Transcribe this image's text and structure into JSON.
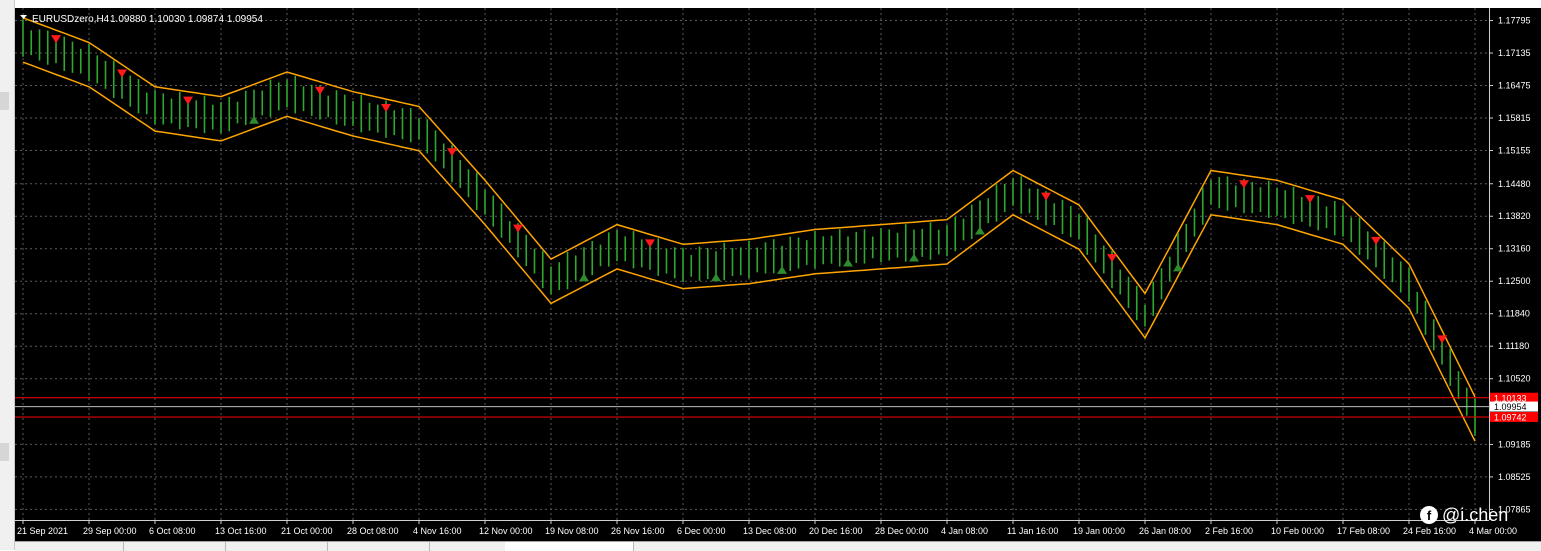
{
  "chart_header": {
    "symbol_timeframe": "EURUSDzero,H4",
    "ohlc": "1.09880 1.10030 1.09874 1.09954"
  },
  "price_axis": {
    "labels": [
      "1.17795",
      "1.17135",
      "1.16475",
      "1.15815",
      "1.15155",
      "1.14480",
      "1.13820",
      "1.13160",
      "1.12500",
      "1.11840",
      "1.11180",
      "1.10520",
      "1.09185",
      "1.08525",
      "1.07865"
    ]
  },
  "price_lines": {
    "upper": "1.10133",
    "current": "1.09954",
    "lower": "1.09742"
  },
  "time_axis": {
    "labels": [
      "21 Sep 2021",
      "29 Sep 00:00",
      "6 Oct 08:00",
      "13 Oct 16:00",
      "21 Oct 00:00",
      "28 Oct 08:00",
      "4 Nov 16:00",
      "12 Nov 00:00",
      "19 Nov 08:00",
      "26 Nov 16:00",
      "6 Dec 00:00",
      "13 Dec 08:00",
      "20 Dec 16:00",
      "28 Dec 00:00",
      "4 Jan 08:00",
      "11 Jan 16:00",
      "19 Jan 00:00",
      "26 Jan 08:00",
      "2 Feb 16:00",
      "10 Feb 00:00",
      "17 Feb 08:00",
      "24 Feb 16:00",
      "4 Mar 00:00"
    ]
  },
  "watermark": {
    "icon": "f",
    "text": "@i.chen"
  },
  "colors": {
    "background": "#000000",
    "candles": "#2ea82e",
    "envelope": "#ffa500",
    "sell_arrow": "#ff1a1a",
    "buy_arrow": "#2e8b2e",
    "grid": "#5a5a5a",
    "level_line": "#ff0000"
  },
  "chart_data": {
    "type": "line",
    "title": "EURUSDzero,H4",
    "x": [
      "21 Sep 2021",
      "29 Sep 00:00",
      "6 Oct 08:00",
      "13 Oct 16:00",
      "21 Oct 00:00",
      "28 Oct 08:00",
      "4 Nov 16:00",
      "12 Nov 00:00",
      "19 Nov 08:00",
      "26 Nov 16:00",
      "6 Dec 00:00",
      "13 Dec 08:00",
      "20 Dec 16:00",
      "28 Dec 00:00",
      "4 Jan 08:00",
      "11 Jan 16:00",
      "19 Jan 00:00",
      "26 Jan 08:00",
      "2 Feb 16:00",
      "10 Feb 00:00",
      "17 Feb 08:00",
      "24 Feb 16:00",
      "4 Mar 00:00"
    ],
    "series": [
      {
        "values": [
          1.174,
          1.169,
          1.16,
          1.158,
          1.163,
          1.159,
          1.156,
          1.141,
          1.125,
          1.132,
          1.128,
          1.129,
          1.131,
          1.132,
          1.133,
          1.143,
          1.136,
          1.118,
          1.143,
          1.141,
          1.137,
          1.124,
          1.097
        ]
      }
    ],
    "ylim": [
      1.0765,
      1.1805
    ],
    "y_ticks": [
      1.17795,
      1.17135,
      1.16475,
      1.15815,
      1.15155,
      1.1448,
      1.1382,
      1.1316,
      1.125,
      1.1184,
      1.1118,
      1.1052,
      1.09185,
      1.08525,
      1.07865
    ],
    "levels": [
      1.10133,
      1.09954,
      1.09742
    ],
    "grid": true
  }
}
